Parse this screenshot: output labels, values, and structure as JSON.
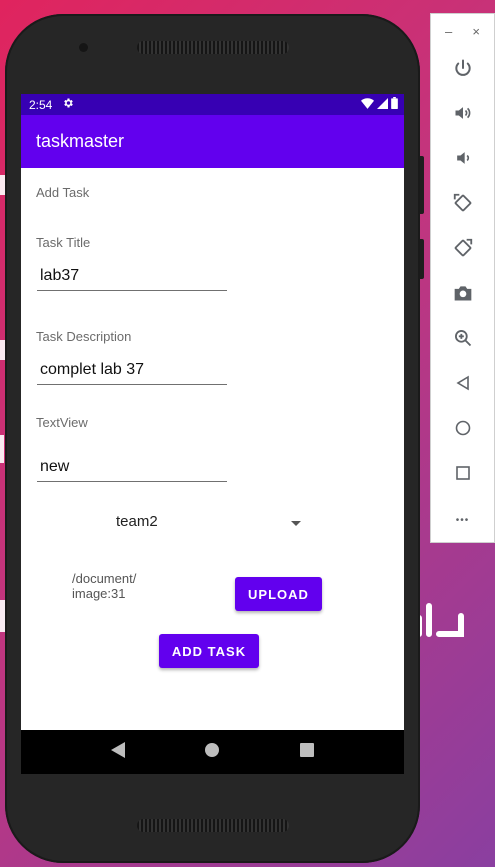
{
  "status": {
    "time": "2:54"
  },
  "app": {
    "title": "taskmaster"
  },
  "form": {
    "heading": "Add Task",
    "title_label": "Task Title",
    "title_value": "lab37",
    "desc_label": "Task Description",
    "desc_value": "complet lab 37",
    "textview_label": "TextView",
    "textview_value": "new",
    "team_selected": "team2",
    "uri_line1": "/document/",
    "uri_line2": "image:31",
    "upload_label": "UPLOAD",
    "add_label": "ADD TASK"
  },
  "panel": {
    "minimize": "–",
    "close": "×",
    "more": "•••"
  },
  "colors": {
    "primary": "#6200ee",
    "primary_dark": "#3700b3"
  }
}
